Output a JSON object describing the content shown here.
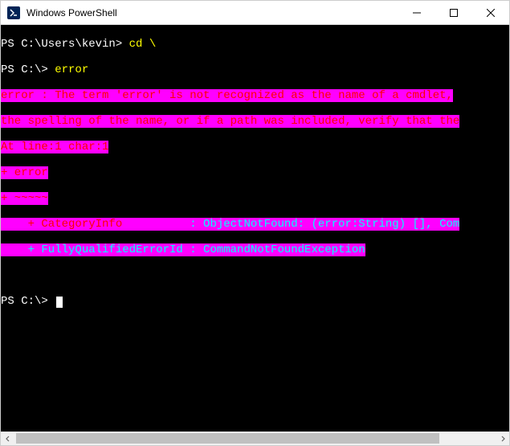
{
  "window": {
    "title": "Windows PowerShell"
  },
  "terminal": {
    "line1_prompt": "PS C:\\Users\\kevin>",
    "line1_cmd": " cd \\",
    "line2_prompt": "PS C:\\>",
    "line2_cmd": " error",
    "err1": "error : The term 'error' is not recognized as the name of a cmdlet,",
    "err2": "the spelling of the name, or if a path was included, verify that the",
    "err3": "At line:1 char:1",
    "err4": "+ error",
    "err5": "+ ~~~~~",
    "err6a": "    + CategoryInfo",
    "err6b": "          : ObjectNotFound: (error:String) [], Com",
    "err7a": "    + FullyQualifiedErrorId : CommandNotFoundException",
    "line_final_prompt": "PS C:\\> "
  }
}
